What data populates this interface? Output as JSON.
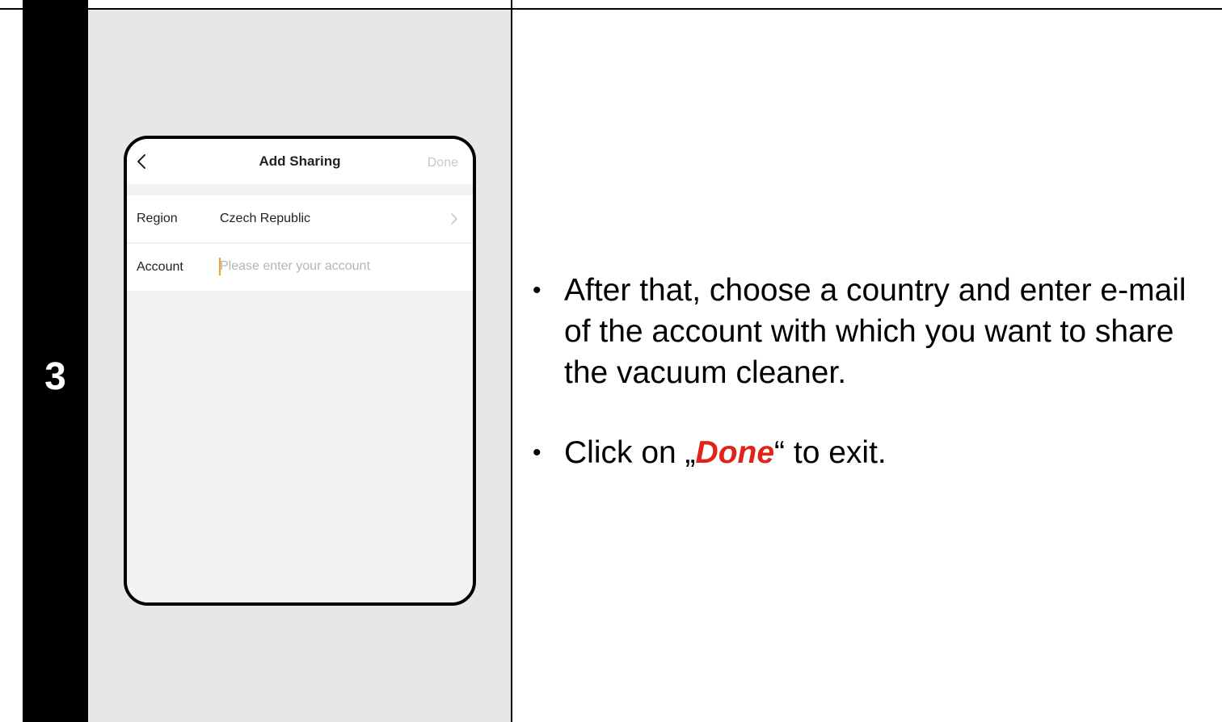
{
  "step": {
    "number": "3"
  },
  "phone": {
    "header": {
      "title": "Add Sharing",
      "done_label": "Done",
      "back_icon": "chevron-left-icon"
    },
    "region": {
      "label": "Region",
      "value": "Czech Republic",
      "icon": "chevron-right-icon"
    },
    "account": {
      "label": "Account",
      "value": "",
      "placeholder": "Please enter your account"
    }
  },
  "instructions": {
    "bullet": "•",
    "item1": "After that, choose a country and enter e-mail of the account with which you want to share the vacuum cleaner.",
    "item2_before": "Click on „",
    "item2_emphasis": "Done",
    "item2_after": "“ to exit."
  },
  "colors": {
    "step_bar": "#000000",
    "panel": "#e7e7e7",
    "emphasis": "#e2231a",
    "done_disabled": "#c8c8c8",
    "caret": "#f0a030"
  }
}
